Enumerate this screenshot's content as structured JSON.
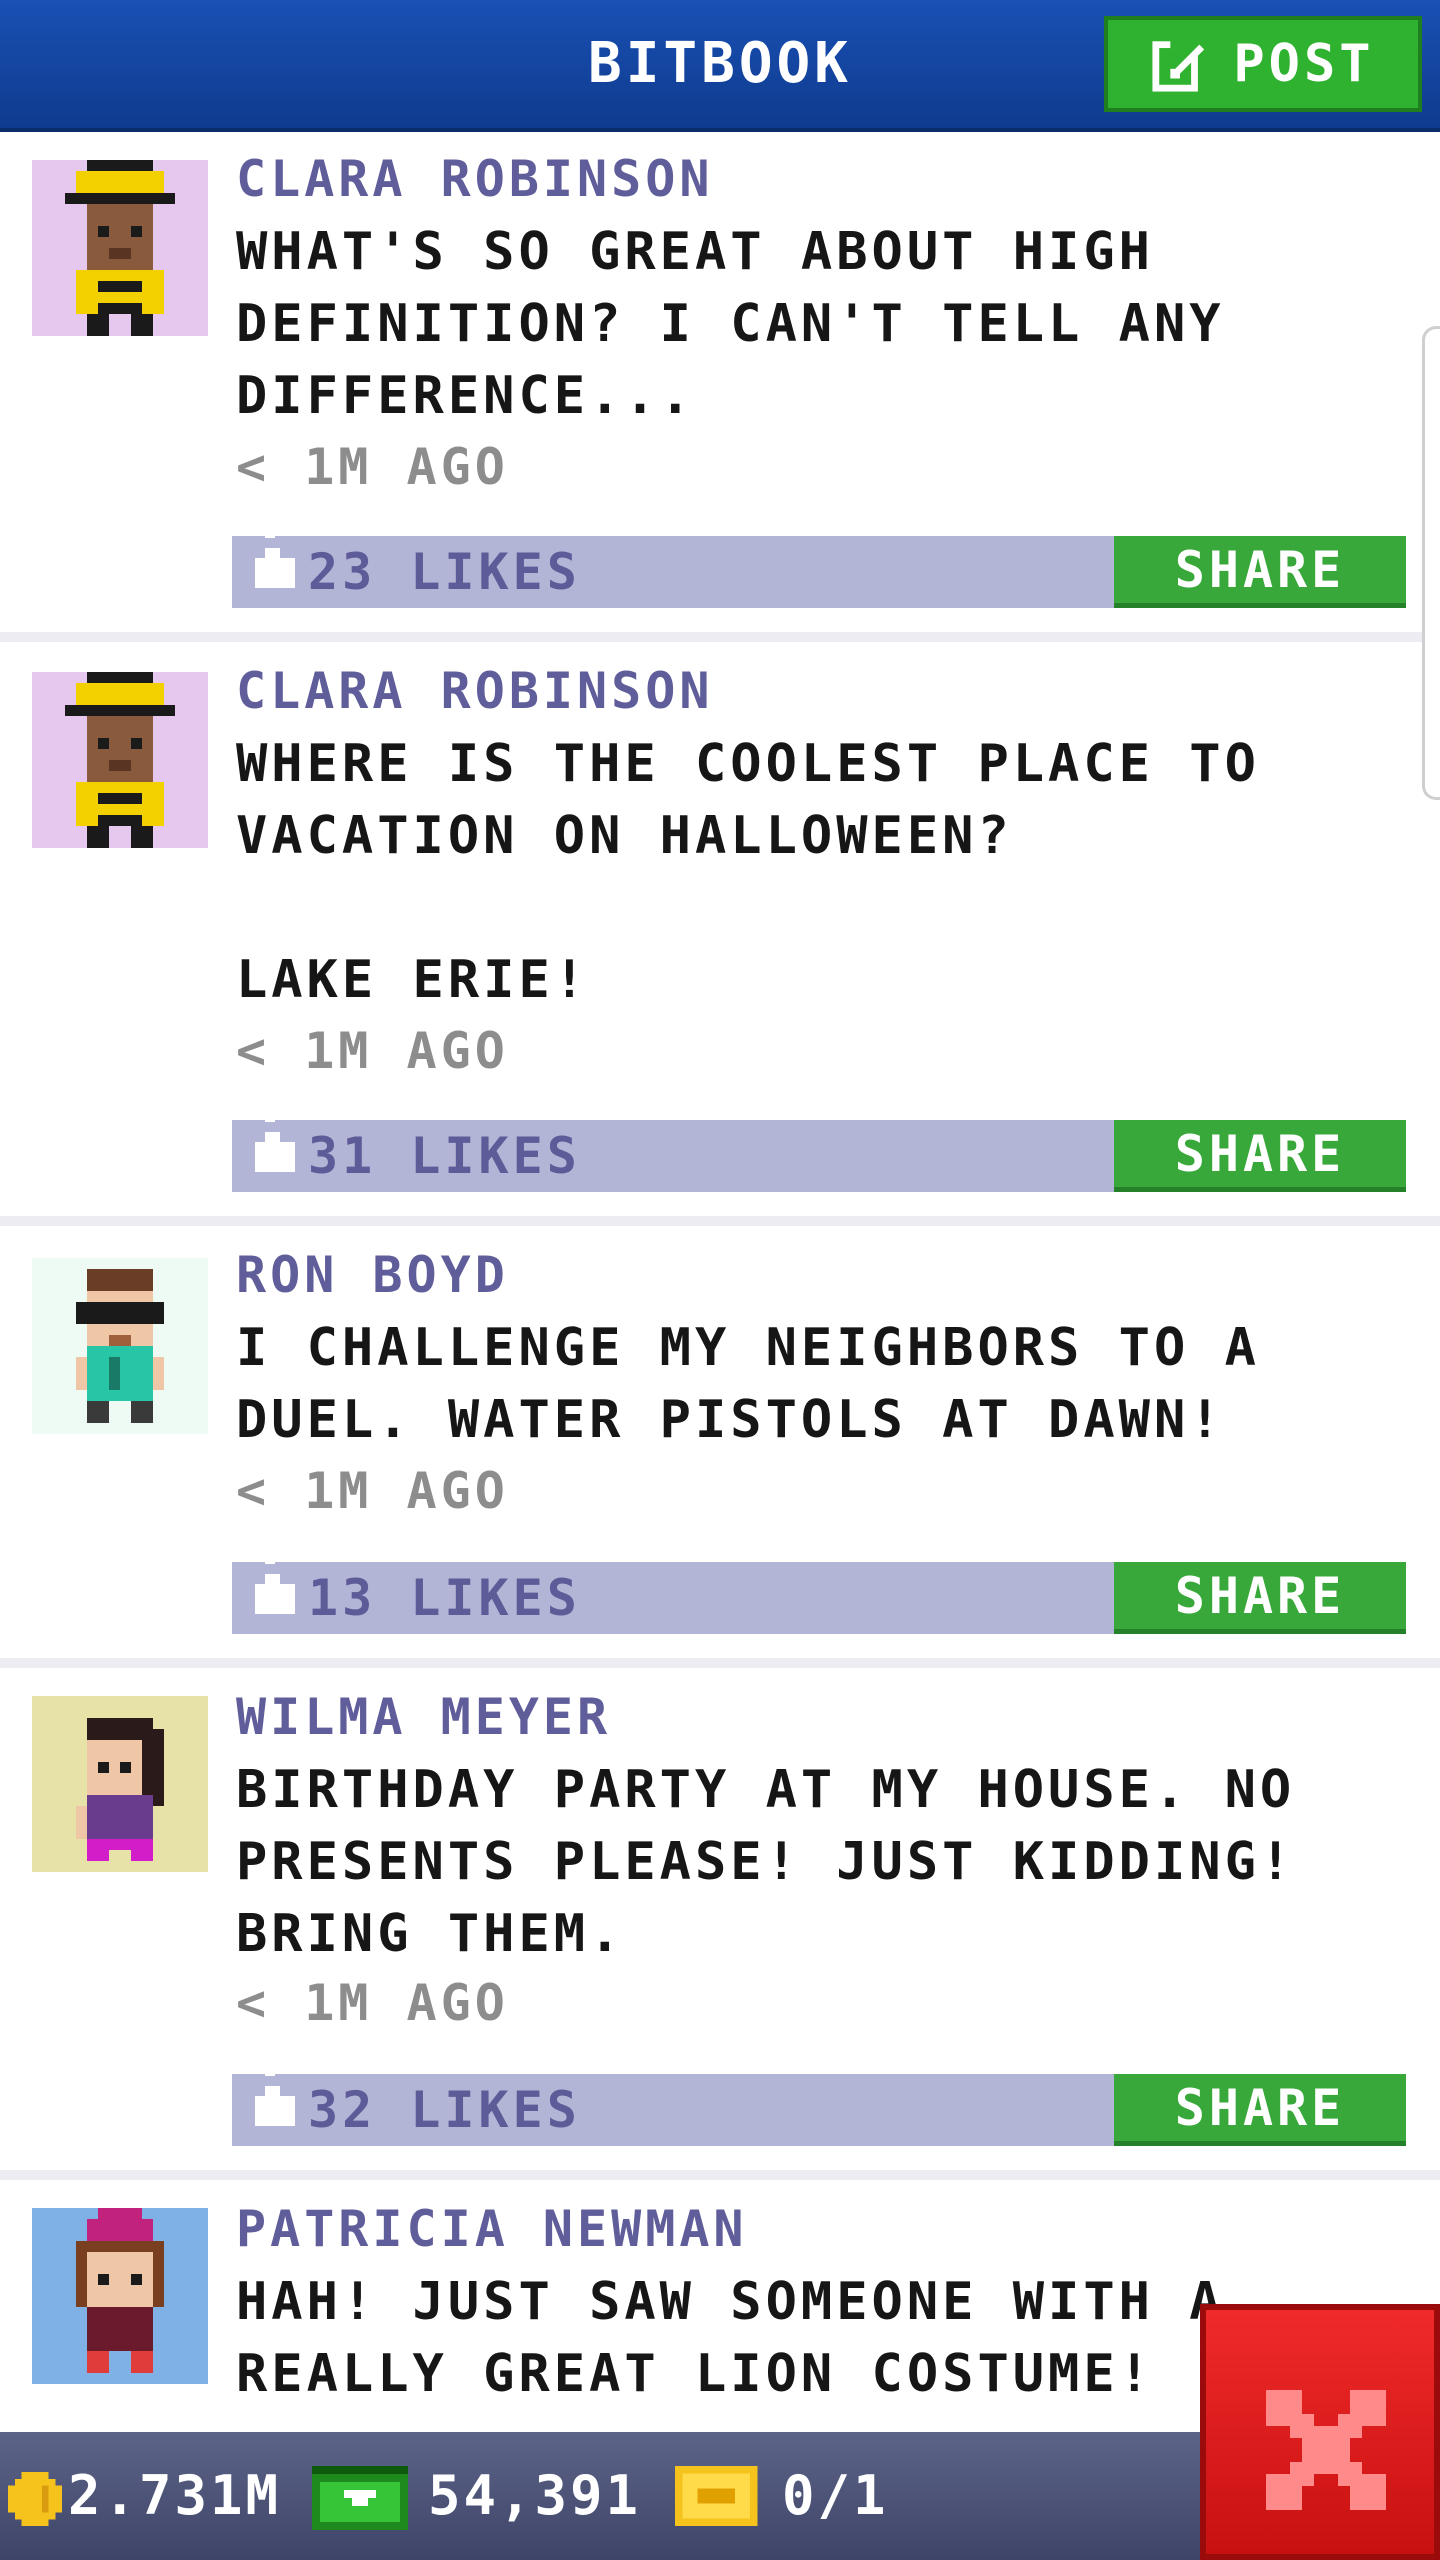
{
  "header": {
    "title": "BITBOOK",
    "post_label": "POST"
  },
  "posts": [
    {
      "author": "CLARA ROBINSON",
      "message": "WHAT'S SO GREAT ABOUT HIGH\nDEFINITION? I CAN'T TELL ANY\nDIFFERENCE...",
      "time": "< 1M AGO",
      "likes": "23 LIKES",
      "share": "SHARE",
      "avatar": "clara-avatar"
    },
    {
      "author": "CLARA ROBINSON",
      "message": "WHERE IS THE COOLEST PLACE TO\nVACATION ON HALLOWEEN?\n\nLAKE ERIE!",
      "time": "< 1M AGO",
      "likes": "31 LIKES",
      "share": "SHARE",
      "avatar": "clara-avatar"
    },
    {
      "author": "RON BOYD",
      "message": "I CHALLENGE MY NEIGHBORS TO A\nDUEL. WATER PISTOLS AT DAWN!",
      "time": "< 1M AGO",
      "likes": "13 LIKES",
      "share": "SHARE",
      "avatar": "ron-avatar"
    },
    {
      "author": "WILMA MEYER",
      "message": "BIRTHDAY PARTY AT MY HOUSE. NO\nPRESENTS PLEASE! JUST KIDDING!\nBRING THEM.",
      "time": "< 1M AGO",
      "likes": "32 LIKES",
      "share": "SHARE",
      "avatar": "wilma-avatar"
    },
    {
      "author": "PATRICIA NEWMAN",
      "message": "HAH! JUST SAW SOMEONE WITH A\nREALLY GREAT LION COSTUME!",
      "avatar": "patricia-avatar"
    }
  ],
  "status": {
    "coins": "2.731M",
    "bux": "54,391",
    "tickets": "0/1"
  },
  "colors": {
    "header": "#1a50b4",
    "green": "#38a83a",
    "likebar": "#b3b5d6",
    "name": "#5f5d9a",
    "close": "#e41e1e"
  }
}
